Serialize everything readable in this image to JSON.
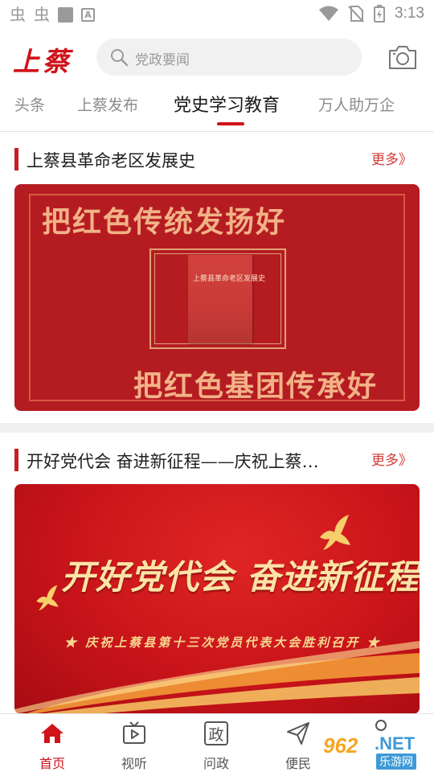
{
  "status_bar": {
    "time": "3:13"
  },
  "header": {
    "logo": "上蔡",
    "search_placeholder": "党政要闻"
  },
  "tabs": [
    {
      "label": "头条"
    },
    {
      "label": "上蔡发布"
    },
    {
      "label": "党史学习教育",
      "active": true
    },
    {
      "label": "万人助万企"
    }
  ],
  "sections": [
    {
      "title": "上蔡县革命老区发展史",
      "more": "更多》",
      "banner": {
        "line1": "把红色传统发扬好",
        "line2": "把红色基团传承好",
        "book_title": "上蔡县革命老区发展史"
      }
    },
    {
      "title": "开好党代会 奋进新征程——庆祝上蔡…",
      "more": "更多》",
      "banner": {
        "headline": "开好党代会 奋进新征程",
        "subline": "★ 庆祝上蔡县第十三次党员代表大会胜利召开 ★"
      }
    }
  ],
  "bottom_nav": [
    {
      "label": "首页",
      "icon": "home-icon",
      "active": true
    },
    {
      "label": "视听",
      "icon": "tv-icon"
    },
    {
      "label": "问政",
      "icon": "zheng-icon",
      "glyph": "政"
    },
    {
      "label": "便民",
      "icon": "send-icon"
    }
  ],
  "watermark": {
    "brand": "962",
    "suffix": ".NET",
    "cn": "乐游网"
  },
  "colors": {
    "brand_red": "#d0121b",
    "banner_red": "#b51c22",
    "gold": "#f2b287"
  }
}
